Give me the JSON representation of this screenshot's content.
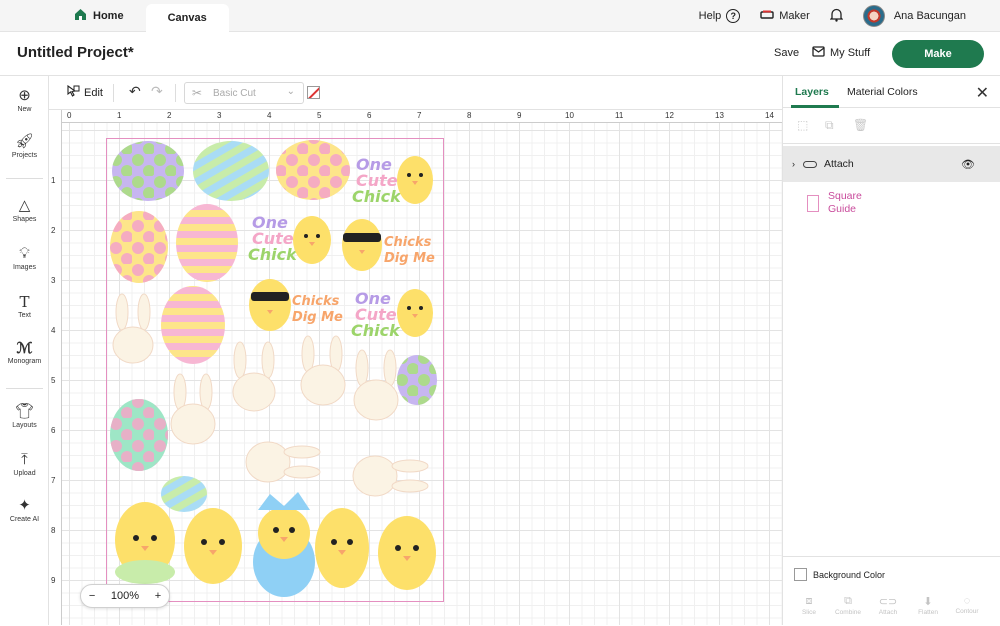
{
  "topbar": {
    "home_label": "Home",
    "canvas_label": "Canvas",
    "help_label": "Help",
    "maker_label": "Maker",
    "user_name": "Ana Bacungan"
  },
  "header": {
    "project_title": "Untitled Project*",
    "save_label": "Save",
    "mystuff_label": "My Stuff",
    "make_label": "Make"
  },
  "leftbar": {
    "items": [
      {
        "label": "New",
        "icon": "plus-circle-icon"
      },
      {
        "label": "Projects",
        "icon": "rocket-icon"
      },
      {
        "label": "Shapes",
        "icon": "shapes-icon"
      },
      {
        "label": "Images",
        "icon": "lightbulb-icon"
      },
      {
        "label": "Text",
        "icon": "text-t-icon"
      },
      {
        "label": "Monogram",
        "icon": "monogram-icon"
      },
      {
        "label": "Layouts",
        "icon": "shirt-icon"
      },
      {
        "label": "Upload",
        "icon": "upload-icon"
      },
      {
        "label": "Create AI",
        "icon": "sparkle-icon"
      }
    ]
  },
  "toolbar": {
    "edit_label": "Edit",
    "operation_value": "Basic Cut"
  },
  "canvas": {
    "ruler_top": [
      "0",
      "1",
      "2",
      "3",
      "4",
      "5",
      "6",
      "7",
      "8",
      "9",
      "10",
      "11",
      "12",
      "13",
      "14"
    ],
    "ruler_left": [
      "1",
      "2",
      "3",
      "4",
      "5",
      "6",
      "7",
      "8",
      "9"
    ],
    "zoom_level": "100%",
    "zoom_minus": "−",
    "zoom_plus": "+",
    "sticker_text": {
      "one_cute_chick": [
        "One",
        "Cute",
        "Chick"
      ],
      "chicks_dig_me": [
        "Chicks",
        "Dig Me"
      ]
    }
  },
  "rightpanel": {
    "tab_layers": "Layers",
    "tab_material": "Material Colors",
    "layers": [
      {
        "name": "Attach",
        "type": "group"
      },
      {
        "name_line1": "Square",
        "name_line2": "Guide",
        "type": "guide"
      }
    ],
    "background_color_label": "Background Color",
    "actions": [
      "Slice",
      "Combine",
      "Attach",
      "Flatten",
      "Contour"
    ]
  },
  "colors": {
    "accent": "#1f7a4f",
    "guide_pink": "#e48fc0"
  }
}
